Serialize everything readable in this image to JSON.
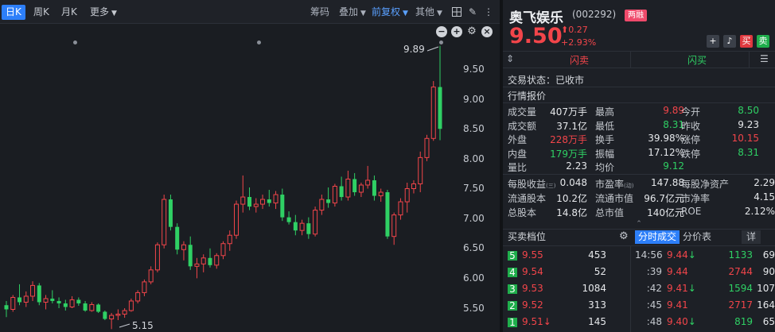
{
  "toolbar": {
    "tabs": [
      "日K",
      "周K",
      "月K",
      "更多"
    ],
    "right": [
      "筹码",
      "叠加",
      "前复权",
      "其他"
    ]
  },
  "chart_data": {
    "type": "candlestick",
    "y_ticks": [
      "9.50",
      "9.00",
      "8.50",
      "8.00",
      "7.50",
      "7.00",
      "6.50",
      "6.00",
      "5.50"
    ],
    "max_label": "9.89",
    "min_label": "5.15",
    "ylim": [
      5.3,
      9.9
    ],
    "candles": [
      [
        5.55,
        5.62,
        5.35,
        5.48
      ],
      [
        5.48,
        5.72,
        5.44,
        5.68
      ],
      [
        5.68,
        5.9,
        5.55,
        5.6
      ],
      [
        5.6,
        5.78,
        5.52,
        5.7
      ],
      [
        5.7,
        5.95,
        5.62,
        5.88
      ],
      [
        5.88,
        5.92,
        5.55,
        5.6
      ],
      [
        5.6,
        5.72,
        5.48,
        5.66
      ],
      [
        5.66,
        5.8,
        5.58,
        5.62
      ],
      [
        5.62,
        5.68,
        5.5,
        5.58
      ],
      [
        5.58,
        5.64,
        5.46,
        5.52
      ],
      [
        5.52,
        5.7,
        5.5,
        5.64
      ],
      [
        5.64,
        5.68,
        5.54,
        5.58
      ],
      [
        5.58,
        5.62,
        5.44,
        5.46
      ],
      [
        5.46,
        5.6,
        5.44,
        5.56
      ],
      [
        5.56,
        5.58,
        5.42,
        5.44
      ],
      [
        5.44,
        5.46,
        5.3,
        5.32
      ],
      [
        5.32,
        5.42,
        5.15,
        5.38
      ],
      [
        5.38,
        5.48,
        5.3,
        5.4
      ],
      [
        5.4,
        5.5,
        5.34,
        5.46
      ],
      [
        5.46,
        5.66,
        5.44,
        5.62
      ],
      [
        5.62,
        5.8,
        5.58,
        5.76
      ],
      [
        5.76,
        5.98,
        5.7,
        5.94
      ],
      [
        5.94,
        6.2,
        5.9,
        6.14
      ],
      [
        6.14,
        6.6,
        6.1,
        6.56
      ],
      [
        6.56,
        7.4,
        6.5,
        7.32
      ],
      [
        7.32,
        7.4,
        6.8,
        6.86
      ],
      [
        6.86,
        6.92,
        6.4,
        6.48
      ],
      [
        6.48,
        6.62,
        6.3,
        6.56
      ],
      [
        6.56,
        6.7,
        6.14,
        6.2
      ],
      [
        6.2,
        6.34,
        6.0,
        6.24
      ],
      [
        6.24,
        6.4,
        6.1,
        6.34
      ],
      [
        6.34,
        6.5,
        6.18,
        6.22
      ],
      [
        6.22,
        6.42,
        6.16,
        6.38
      ],
      [
        6.38,
        6.62,
        6.32,
        6.58
      ],
      [
        6.58,
        6.8,
        6.46,
        6.72
      ],
      [
        6.72,
        7.3,
        6.66,
        7.24
      ],
      [
        7.24,
        7.72,
        7.1,
        7.36
      ],
      [
        7.36,
        7.52,
        7.14,
        7.2
      ],
      [
        7.2,
        7.34,
        7.1,
        7.24
      ],
      [
        7.24,
        7.4,
        7.16,
        7.32
      ],
      [
        7.32,
        7.48,
        7.2,
        7.26
      ],
      [
        7.26,
        7.46,
        7.16,
        7.4
      ],
      [
        7.4,
        7.5,
        6.96,
        7.02
      ],
      [
        7.02,
        7.12,
        6.9,
        6.94
      ],
      [
        6.94,
        7.06,
        6.72,
        6.8
      ],
      [
        6.8,
        6.98,
        6.72,
        6.92
      ],
      [
        6.92,
        7.02,
        6.66,
        6.74
      ],
      [
        6.74,
        7.2,
        6.7,
        7.14
      ],
      [
        7.14,
        7.4,
        7.06,
        7.32
      ],
      [
        7.32,
        7.52,
        7.18,
        7.26
      ],
      [
        7.26,
        7.58,
        7.2,
        7.54
      ],
      [
        7.54,
        7.7,
        7.3,
        7.36
      ],
      [
        7.36,
        7.8,
        7.3,
        7.66
      ],
      [
        7.66,
        7.76,
        7.38,
        7.44
      ],
      [
        7.44,
        7.6,
        7.36,
        7.56
      ],
      [
        7.56,
        7.88,
        7.5,
        7.64
      ],
      [
        7.64,
        7.72,
        7.3,
        7.38
      ],
      [
        7.38,
        7.5,
        7.28,
        7.44
      ],
      [
        7.44,
        7.48,
        6.66,
        6.7
      ],
      [
        6.7,
        7.1,
        6.56,
        7.06
      ],
      [
        7.06,
        7.34,
        6.98,
        7.28
      ],
      [
        7.28,
        7.6,
        7.1,
        7.5
      ],
      [
        7.5,
        7.64,
        7.42,
        7.58
      ],
      [
        7.58,
        8.12,
        7.44,
        8.02
      ],
      [
        8.02,
        8.4,
        7.96,
        8.34
      ],
      [
        8.34,
        9.3,
        8.3,
        9.2
      ],
      [
        9.2,
        9.89,
        8.31,
        8.5
      ]
    ]
  },
  "stock": {
    "name": "奥飞娱乐",
    "code": "(002292)",
    "badge": "两融",
    "price": "9.50",
    "change": "0.27",
    "change_pct": "+2.93%",
    "flash_sell": "闪卖",
    "flash_buy": "闪买",
    "buy_btn": "买",
    "sell_btn": "卖"
  },
  "status": "交易状态：已收市",
  "quote_title": "行情报价",
  "quotes": [
    [
      {
        "k": "成交量",
        "v": "407万手",
        "c": "white"
      },
      {
        "k": "最高",
        "v": "9.89",
        "c": "red"
      },
      {
        "k": "今开",
        "v": "8.50",
        "c": "green"
      }
    ],
    [
      {
        "k": "成交额",
        "v": "37.1亿",
        "c": "white"
      },
      {
        "k": "最低",
        "v": "8.31",
        "c": "green"
      },
      {
        "k": "昨收",
        "v": "9.23",
        "c": "white"
      }
    ],
    [
      {
        "k": "外盘",
        "v": "228万手",
        "c": "red"
      },
      {
        "k": "换手",
        "v": "39.98%",
        "c": "white"
      },
      {
        "k": "涨停",
        "v": "10.15",
        "c": "red"
      }
    ],
    [
      {
        "k": "内盘",
        "v": "179万手",
        "c": "green"
      },
      {
        "k": "振幅",
        "v": "17.12%",
        "c": "white"
      },
      {
        "k": "跌停",
        "v": "8.31",
        "c": "green"
      }
    ],
    [
      {
        "k": "量比",
        "v": "2.23",
        "c": "white"
      },
      {
        "k": "均价",
        "v": "9.12",
        "c": "green"
      },
      {
        "k": "",
        "v": "",
        "c": "white"
      }
    ]
  ],
  "fundamentals": [
    [
      {
        "k": "每股收益",
        "sub": "(三)",
        "v": "0.048"
      },
      {
        "k": "市盈率",
        "sub": "(动)",
        "v": "147.88"
      },
      {
        "k": "每股净资产",
        "sub": "",
        "v": "2.29"
      }
    ],
    [
      {
        "k": "流通股本",
        "sub": "",
        "v": "10.2亿"
      },
      {
        "k": "流通市值",
        "sub": "",
        "v": "96.7亿元"
      },
      {
        "k": "市净率",
        "sub": "",
        "v": "4.15"
      }
    ],
    [
      {
        "k": "总股本",
        "sub": "",
        "v": "14.8亿"
      },
      {
        "k": "总市值",
        "sub": "",
        "v": "140亿元"
      },
      {
        "k": "ROE",
        "sub": "",
        "v": "2.12%"
      }
    ]
  ],
  "book_title": "买卖档位",
  "tick_tabs": [
    "分时成交",
    "分价表"
  ],
  "detail_btn": "详",
  "book": [
    {
      "lvl": "5",
      "price": "9.55",
      "vol": "453",
      "c": "red",
      "arrow": ""
    },
    {
      "lvl": "4",
      "price": "9.54",
      "vol": "52",
      "c": "red",
      "arrow": ""
    },
    {
      "lvl": "3",
      "price": "9.53",
      "vol": "1084",
      "c": "red",
      "arrow": ""
    },
    {
      "lvl": "2",
      "price": "9.52",
      "vol": "313",
      "c": "red",
      "arrow": ""
    },
    {
      "lvl": "1",
      "price": "9.51",
      "vol": "145",
      "c": "red",
      "arrow": "↓"
    }
  ],
  "ticks": [
    {
      "t": "14:56",
      "p": "9.44",
      "a": "↓",
      "v": "1133",
      "vc": "green",
      "n": "69"
    },
    {
      "t": ":39",
      "p": "9.44",
      "a": "",
      "v": "2744",
      "vc": "red",
      "n": "90"
    },
    {
      "t": ":42",
      "p": "9.41",
      "a": "↓",
      "v": "1594",
      "vc": "green",
      "n": "107"
    },
    {
      "t": ":45",
      "p": "9.41",
      "a": "",
      "v": "2717",
      "vc": "red",
      "n": "164"
    },
    {
      "t": ":48",
      "p": "9.40",
      "a": "↓",
      "v": "819",
      "vc": "green",
      "n": "65"
    }
  ]
}
